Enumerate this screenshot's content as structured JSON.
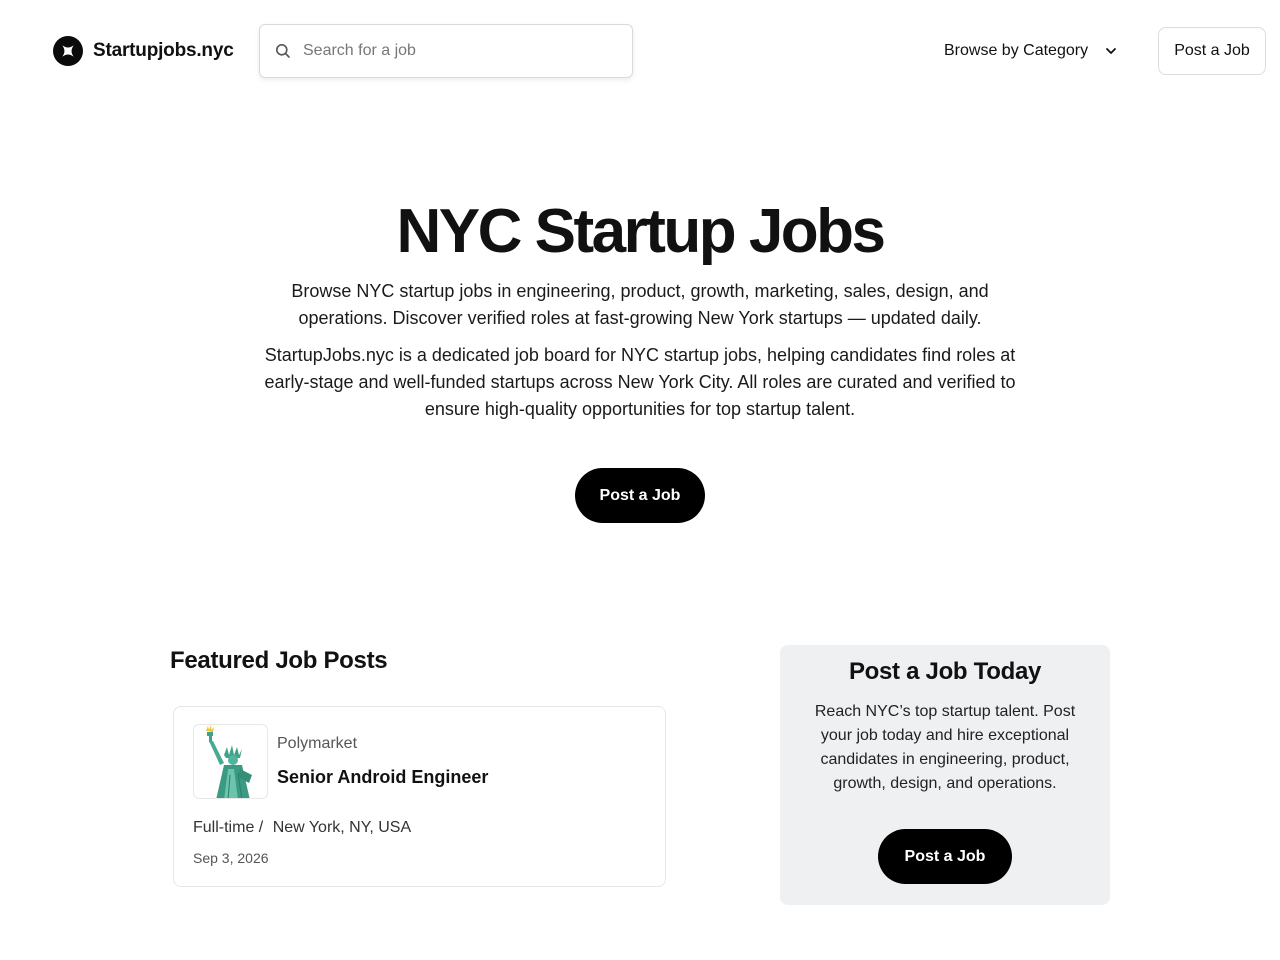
{
  "header": {
    "brand": "Startupjobs.nyc",
    "search_placeholder": "Search for a job",
    "browse_label": "Browse by Category",
    "post_label": "Post a Job"
  },
  "hero": {
    "title": "NYC Startup Jobs",
    "description": "Browse NYC startup jobs in engineering, product, growth, marketing, sales, design, and operations. Discover verified roles at fast-growing New York startups — updated daily.",
    "about": "StartupJobs.nyc is a dedicated job board for NYC startup jobs, helping candidates find roles at early-stage and well-funded startups across New York City. All roles are curated and verified to ensure high-quality opportunities for top startup talent.",
    "cta_label": "Post a Job"
  },
  "featured": {
    "heading": "Featured Job Posts",
    "jobs": [
      {
        "company": "Polymarket",
        "title": "Senior Android Engineer",
        "employment_type": "Full-time /",
        "location": "New York, NY, USA",
        "date": "Sep 3, 2026",
        "logo_icon": "statue-of-liberty-icon"
      }
    ]
  },
  "side_panel": {
    "title": "Post a Job Today",
    "description": "Reach NYC’s top startup talent. Post your job today and hire exceptional candidates in engineering, product, growth, design, and operations.",
    "cta_label": "Post a Job"
  },
  "icons": {
    "brand": "star-logo-icon",
    "search": "search-icon",
    "browse": "chevron-down-icon"
  },
  "colors": {
    "primary_button": "#000000",
    "panel_background": "#eff0f1",
    "statue_green": "#3fa38b"
  }
}
